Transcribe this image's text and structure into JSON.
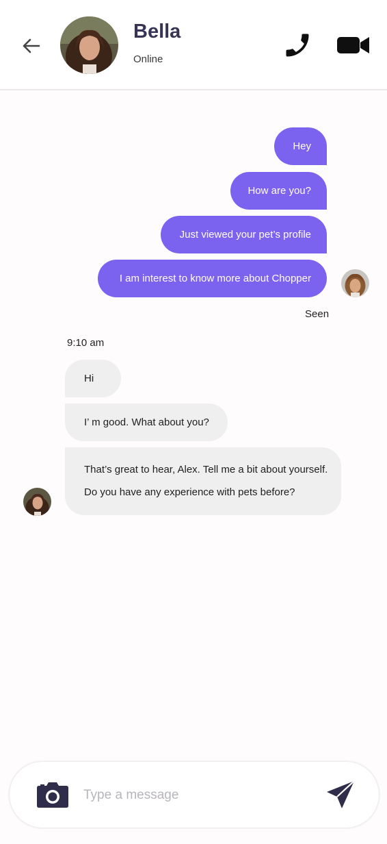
{
  "header": {
    "contact_name": "Bella",
    "status": "Online"
  },
  "conversation": {
    "sent_messages": [
      "Hey",
      "How are you?",
      "Just viewed your pet’s profile",
      "I am interest to know more about Chopper"
    ],
    "seen_label": "Seen",
    "timestamp": "9:10 am",
    "received_messages": [
      "Hi",
      "I’ m good. What about you?"
    ],
    "received_long": {
      "line1": "That’s great to hear, Alex. Tell me a bit about yourself.",
      "line2": "Do you have any experience with pets before?"
    }
  },
  "composer": {
    "placeholder": "Type a message"
  },
  "icons": {
    "back": "arrow-left-icon",
    "call": "phone-icon",
    "video": "video-camera-icon",
    "camera": "camera-icon",
    "send": "send-icon"
  },
  "colors": {
    "accent": "#7b63ef",
    "received_bubble": "#efefef",
    "name_text": "#363353",
    "icon_dark": "#2f2d4a"
  }
}
